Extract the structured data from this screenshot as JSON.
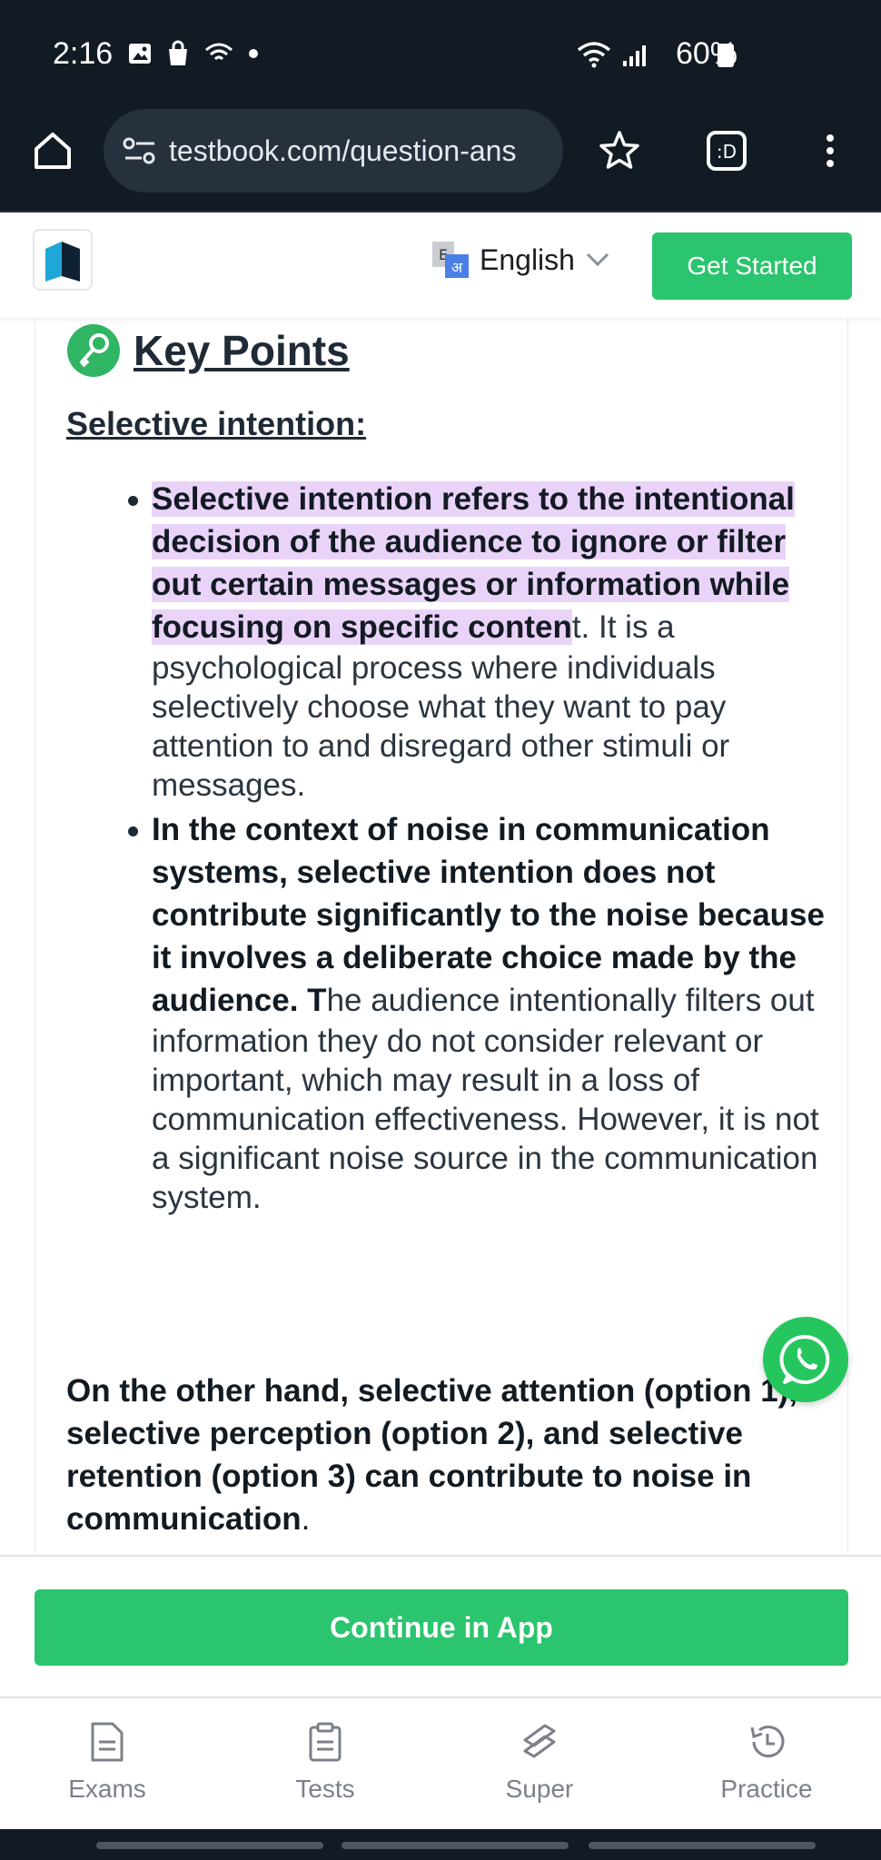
{
  "status_bar": {
    "time": "2:16",
    "battery": "60%"
  },
  "browser": {
    "url": "testbook.com/question-ans"
  },
  "header": {
    "language": "English",
    "get_started": "Get Started"
  },
  "content": {
    "key_points_title": "Key Points",
    "section_heading": "Selective intention:",
    "bullet1": {
      "highlight": "Selective intention refers to the intentional decision of the audience to ignore or filter out certain messages or information while focusing on specific conten",
      "rest": "t. It is a psychological process where individuals selectively choose what they want to pay attention to and disregard other stimuli or messages."
    },
    "bullet2": {
      "bold": "In the context of noise in communication systems, selective intention does not contribute significantly to the noise because it involves a deliberate choice made by the audience. T",
      "rest": "he audience intentionally filters out information they do not consider relevant or important, which may result in a loss of communication effectiveness. However, it is not a significant noise source in the communication system."
    },
    "other_hand": "On the other hand, selective attention (option 1), selective perception (option 2), and selective retention (option 3) can contribute to noise in communication",
    "other_hand_end": "."
  },
  "continue_button": "Continue in App",
  "bottom_nav": [
    {
      "label": "Exams",
      "icon": "document-icon"
    },
    {
      "label": "Tests",
      "icon": "clipboard-icon"
    },
    {
      "label": "Super",
      "icon": "super-logo-icon"
    },
    {
      "label": "Practice",
      "icon": "history-icon"
    }
  ],
  "colors": {
    "brand_green": "#2ac56e",
    "highlight": "#ead3f8",
    "dark_bar": "#121a24"
  }
}
